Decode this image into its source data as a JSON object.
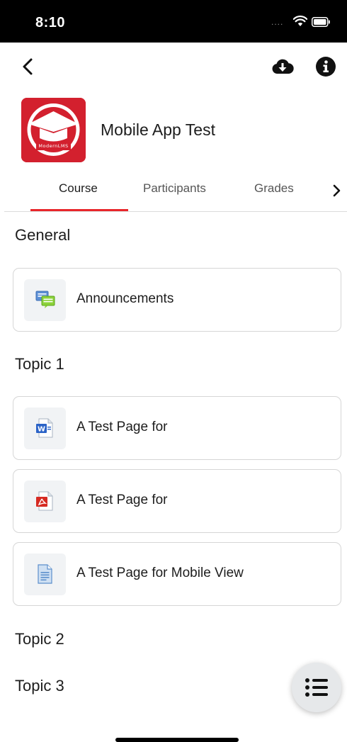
{
  "status_bar": {
    "time": "8:10",
    "signal_dots": "....",
    "wifi_icon": "wifi-icon",
    "battery_icon": "battery-icon"
  },
  "header": {
    "back_icon": "chevron-left-icon",
    "download_icon": "cloud-download-icon",
    "info_icon": "info-icon"
  },
  "course": {
    "title": "Mobile App Test",
    "logo_text": "ModernLMS",
    "logo_color": "#d3202e"
  },
  "tabs": [
    {
      "label": "Course",
      "active": true
    },
    {
      "label": "Participants",
      "active": false
    },
    {
      "label": "Grades",
      "active": false
    }
  ],
  "accent_color": "#e8262b",
  "sections": [
    {
      "title": "General",
      "activities": [
        {
          "label": "Announcements",
          "icon": "forum-icon"
        }
      ]
    },
    {
      "title": "Topic 1",
      "activities": [
        {
          "label": "A Test Page for",
          "icon": "word-document-icon"
        },
        {
          "label": "A Test Page for",
          "icon": "pdf-document-icon"
        },
        {
          "label": "A Test Page for Mobile View",
          "icon": "page-icon"
        }
      ]
    },
    {
      "title": "Topic 2",
      "activities": []
    },
    {
      "title": "Topic 3",
      "activities": []
    }
  ],
  "fab": {
    "icon": "course-index-list-icon"
  }
}
